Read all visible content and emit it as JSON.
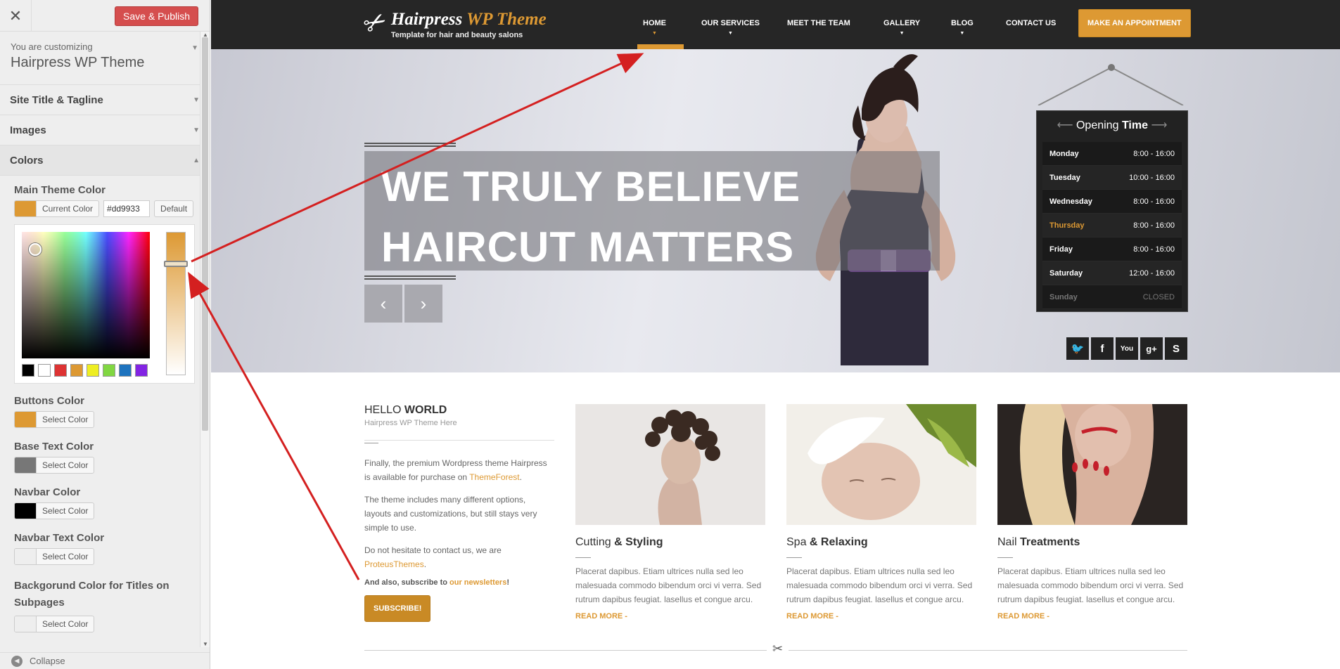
{
  "customizer": {
    "close_icon": "close-icon",
    "publish_label": "Save & Publish",
    "customizing_label": "You are customizing",
    "theme_name": "Hairpress WP Theme",
    "sections": [
      {
        "label": "Site Title & Tagline"
      },
      {
        "label": "Images"
      },
      {
        "label": "Colors"
      }
    ],
    "colors": {
      "main_label": "Main Theme Color",
      "current_color_label": "Current Color",
      "hex_value": "#dd9933",
      "default_label": "Default",
      "select_label": "Select Color",
      "palette": [
        "#000000",
        "#ffffff",
        "#dd3333",
        "#dd9933",
        "#eeee22",
        "#81d742",
        "#1e73be",
        "#8224e3"
      ],
      "fields": [
        {
          "label": "Buttons Color",
          "swatch": "#dd9933"
        },
        {
          "label": "Base Text Color",
          "swatch": "#777777"
        },
        {
          "label": "Navbar Color",
          "swatch": "#000000"
        },
        {
          "label": "Navbar Text Color",
          "swatch": "#eeeeee"
        },
        {
          "label": "Backgorund Color for Titles on Subpages",
          "swatch": "#eeeeee"
        }
      ]
    },
    "collapse_label": "Collapse"
  },
  "site": {
    "logo_title_a": "Hairpress",
    "logo_title_b": "WP Theme",
    "logo_tagline": "Template for hair and beauty salons",
    "nav": [
      {
        "label": "HOME"
      },
      {
        "label": "OUR SERVICES"
      },
      {
        "label": "MEET THE TEAM"
      },
      {
        "label": "GALLERY"
      },
      {
        "label": "BLOG"
      },
      {
        "label": "CONTACT US"
      }
    ],
    "appointment_label": "MAKE AN APPOINTMENT",
    "accent_color": "#dd9933"
  },
  "hero": {
    "line1": "WE TRULY BELIEVE",
    "line2": "HAIRCUT MATTERS",
    "prev_icon": "chevron-left-icon",
    "next_icon": "chevron-right-icon"
  },
  "opening_time": {
    "title_a": "Opening",
    "title_b": "Time",
    "rows": [
      {
        "day": "Monday",
        "hours": "8:00 - 16:00"
      },
      {
        "day": "Tuesday",
        "hours": "10:00 - 16:00"
      },
      {
        "day": "Wednesday",
        "hours": "8:00 - 16:00"
      },
      {
        "day": "Thursday",
        "hours": "8:00 - 16:00"
      },
      {
        "day": "Friday",
        "hours": "8:00 - 16:00"
      },
      {
        "day": "Saturday",
        "hours": "12:00 - 16:00"
      },
      {
        "day": "Sunday",
        "hours": "CLOSED"
      }
    ]
  },
  "social": [
    "twitter-icon",
    "facebook-icon",
    "youtube-icon",
    "google-plus-icon",
    "skype-icon"
  ],
  "hello": {
    "title_a": "HELLO",
    "title_b": "WORLD",
    "subtitle": "Hairpress WP Theme Here",
    "p1_a": "Finally, the premium Wordpress theme Hairpress is available for purchase on",
    "p1_link": "ThemeForest",
    "p1_b": ".",
    "p2": "The theme includes many different options, layouts and customizations, but still stays very simple to use.",
    "p3_a": "Do not hesitate to contact us, we are",
    "p3_link": "ProteusThemes",
    "p3_b": ".",
    "bold_a": "And also, subscribe to",
    "bold_link": "our newsletters",
    "bold_b": "!",
    "subscribe_label": "SUBSCRIBE!"
  },
  "services": [
    {
      "title_a": "Cutting",
      "title_b": "& Styling",
      "text": "Placerat dapibus. Etiam ultrices nulla sed leo malesuada commodo bibendum orci vi verra. Sed rutrum dapibus feugiat. lasellus et congue arcu.",
      "readmore": "READ MORE -"
    },
    {
      "title_a": "Spa",
      "title_b": "& Relaxing",
      "text": "Placerat dapibus. Etiam ultrices nulla sed leo malesuada commodo bibendum orci vi verra. Sed rutrum dapibus feugiat. lasellus et congue arcu.",
      "readmore": "READ MORE -"
    },
    {
      "title_a": "Nail",
      "title_b": "Treatments",
      "text": "Placerat dapibus. Etiam ultrices nulla sed leo malesuada commodo bibendum orci vi verra. Sed rutrum dapibus feugiat. lasellus et congue arcu.",
      "readmore": "READ MORE -"
    }
  ]
}
